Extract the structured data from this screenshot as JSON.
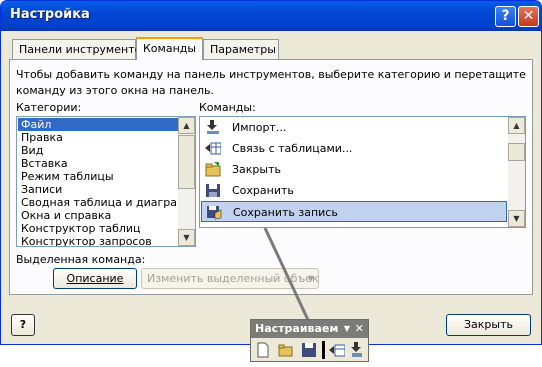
{
  "window": {
    "title": "Настройка",
    "help_label": "?",
    "close_label": "✕"
  },
  "tabs": [
    {
      "label": "Панели инструментов"
    },
    {
      "label": "Команды"
    },
    {
      "label": "Параметры"
    }
  ],
  "instructions": "Чтобы добавить команду на панель инструментов, выберите категорию и перетащите команду из этого окна на панель.",
  "categories": {
    "label": "Категории:",
    "items": [
      "Файл",
      "Правка",
      "Вид",
      "Вставка",
      "Режим таблицы",
      "Записи",
      "Сводная таблица и диаграмма",
      "Окна и справка",
      "Конструктор таблиц",
      "Конструктор запросов"
    ],
    "selected": "Файл"
  },
  "commands": {
    "label": "Команды:",
    "items": [
      {
        "label": "Импорт...",
        "icon": "import-icon"
      },
      {
        "label": "Связь с таблицами...",
        "icon": "link-tables-icon"
      },
      {
        "label": "Закрыть",
        "icon": "close-folder-icon"
      },
      {
        "label": "Сохранить",
        "icon": "floppy-disk-icon"
      },
      {
        "label": "Сохранить запись",
        "icon": "save-record-icon"
      }
    ],
    "selected": "Сохранить запись"
  },
  "selected_command": {
    "label": "Выделенная команда:",
    "describe_button": "Описание",
    "modify_button": "Изменить выделенный объект"
  },
  "footer": {
    "help_button": "?",
    "close_button": "Закрыть"
  },
  "floating_toolbar": {
    "title": "Настраиваем",
    "icons": [
      "new-document-icon",
      "open-folder-icon",
      "save-icon",
      "link-tables-icon",
      "import-icon"
    ]
  },
  "colors": {
    "dialog_bg": "#ece9d8",
    "titlebar_blue": "#0a5ce6",
    "selection_blue": "#316ac5",
    "command_highlight": "#c1d2ee",
    "active_tab_accent": "#ff9a00"
  }
}
